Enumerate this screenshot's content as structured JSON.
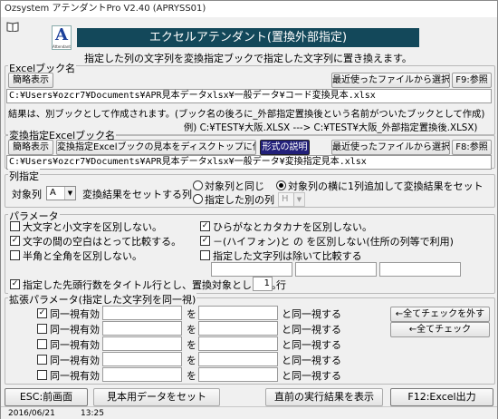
{
  "window": {
    "title": "Ozsystem アテンダントPro V2.40 (APRYSS01)"
  },
  "header": {
    "logo_letter": "A",
    "logo_sub": "Attendant",
    "banner": "エクセルアテンダント(置換外部指定)",
    "description": "指定した列の文字列を変換指定ブックで指定した文字列に置き換えます。"
  },
  "excel_book": {
    "label": "Excelブック名",
    "simple_view": "簡略表示",
    "recent": "最近使ったファイルから選択",
    "browse": "F9:参照",
    "path": "C:¥Users¥ozcr7¥Documents¥APR見本データxlsx¥一般データ¥コード変換見本.xlsx",
    "note1": "結果は、別ブックとして作成されます。(ブック名の後ろに_外部指定置換後という名前がついたブックとして作成)",
    "note2": "例) C:¥TEST¥大阪.XLSX ---> C:¥TEST¥大阪_外部指定置換後.XLSX)"
  },
  "conv_book": {
    "label": "変換指定Excelブック名",
    "simple_view": "簡略表示",
    "desktop": "変換指定Excelブックの見本をディスクトップに作成",
    "format": "形式の説明",
    "recent": "最近使ったファイルから選択",
    "browse": "F8:参照",
    "path": "C:¥Users¥ozcr7¥Documents¥APR見本データxlsx¥一般データ¥変換指定見本.xlsx"
  },
  "column": {
    "label": "列指定",
    "target_label": "対象列",
    "target_value": "A",
    "set_label": "変換結果をセットする列",
    "opt_same": "対象列と同じ",
    "opt_insert": "対象列の横に1列追加して変換結果をセット",
    "opt_other": "指定した別の列",
    "other_value": "H"
  },
  "params": {
    "label": "パラメータ",
    "case": "大文字と小文字を区別しない。",
    "space": "文字の間の空白はとって比較する。",
    "width": "半角と全角を区別しない。",
    "kana": "ひらがなとカタカナを区別しない。",
    "hyphen": "－(ハイフォン)と の を区別しない(住所の列等で利用)",
    "except": "指定した文字列は除いて比較する",
    "header_rows_text": "指定した先頭行数をタイトル行とし、置換対象としない。",
    "header_rows_value": "1",
    "header_rows_unit": "行"
  },
  "ext_params": {
    "label": "拡張パラメータ(指定した文字列を同一視)",
    "row_label": "同一視有効",
    "wo": "を",
    "suffix": "と同一視する",
    "rows": [
      {
        "checked": true
      },
      {
        "checked": false
      },
      {
        "checked": false
      },
      {
        "checked": false
      },
      {
        "checked": false
      }
    ],
    "uncheck_all": "←全てチェックを外す",
    "check_all": "←全てチェック"
  },
  "footer": {
    "esc": "ESC:前画面",
    "sample": "見本用データをセット",
    "last_result": "直前の実行結果を表示",
    "run": "F12:Excel出力"
  },
  "status": {
    "date": "2016/06/21",
    "time": "13:25"
  }
}
